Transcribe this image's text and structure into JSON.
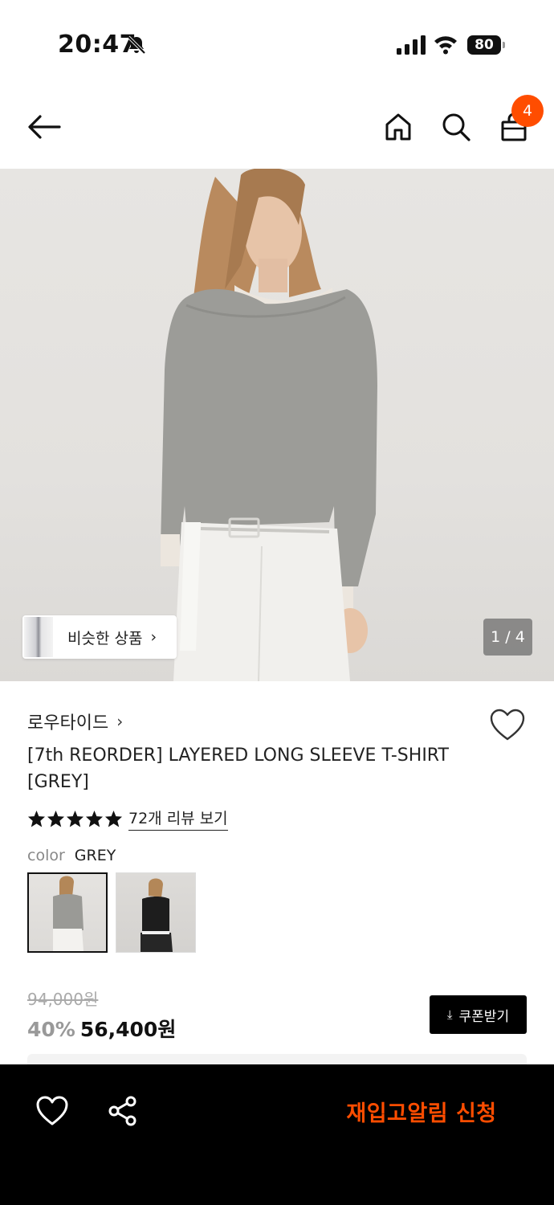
{
  "status_bar": {
    "time": "20:47",
    "battery_level": "80",
    "icons": [
      "bell-slash-icon",
      "cellular-signal-icon",
      "wifi-icon",
      "battery-icon"
    ]
  },
  "nav": {
    "cart_count": "4",
    "icons": [
      "arrow-left-icon",
      "home-icon",
      "search-icon",
      "shopping-bag-icon"
    ]
  },
  "hero": {
    "similar_label": "비슷한 상품",
    "page_counter": "1 / 4"
  },
  "product": {
    "brand": "로우타이드",
    "title": "[7th REORDER] LAYERED LONG SLEEVE T-SHIRT [GREY]",
    "rating_stars": 5,
    "review_link": "72개 리뷰 보기",
    "color_key": "color",
    "color_value": "GREY",
    "original_price": "94,000원",
    "discount": "40%",
    "final_price": "56,400원",
    "coupon_label": "쿠폰받기"
  },
  "bottom_bar": {
    "restock_label": "재입고알림 신청"
  },
  "colors": {
    "accent": "#ff4d00",
    "bottom_bar_bg": "#000000"
  }
}
